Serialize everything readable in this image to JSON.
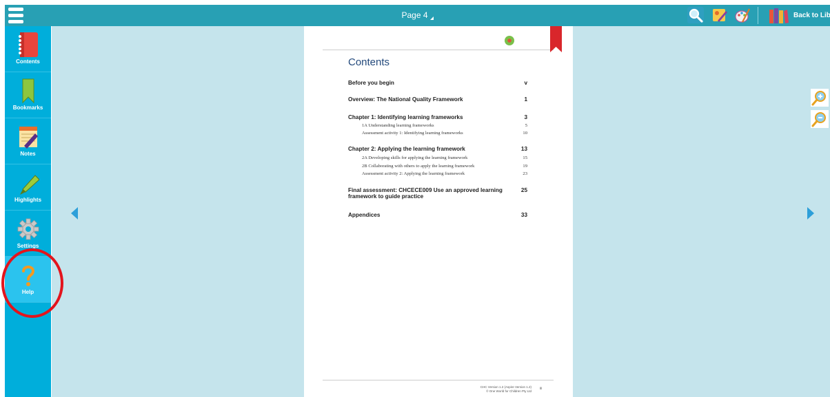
{
  "topbar": {
    "page_label": "Page 4",
    "icons": [
      "menu-icon",
      "search-icon",
      "annotate-icon",
      "draw-icon",
      "library-icon"
    ],
    "back_label": "Back to Library",
    "colors": {
      "bar": "#28a0b4",
      "text": "#ffffff"
    }
  },
  "sidebar": {
    "items": [
      {
        "label": "Contents",
        "icon": "notebook-icon"
      },
      {
        "label": "Bookmarks",
        "icon": "bookmark-icon"
      },
      {
        "label": "Notes",
        "icon": "notes-icon"
      },
      {
        "label": "Highlights",
        "icon": "highlighter-icon"
      },
      {
        "label": "Settings",
        "icon": "gear-icon"
      },
      {
        "label": "Help",
        "icon": "help-icon"
      }
    ],
    "active": "Help",
    "colors": {
      "bg": "#00aedb",
      "active": "#2bc3ee"
    }
  },
  "document": {
    "title": "Contents",
    "toc": [
      {
        "title": "Before you begin",
        "page": "v",
        "level": 1
      },
      {
        "title": "Overview: The National Quality Framework",
        "page": "1",
        "level": 1
      },
      {
        "title": "Chapter 1: Identifying learning frameworks",
        "page": "3",
        "level": 1
      },
      {
        "title": "1A  Understanding learning frameworks",
        "page": "5",
        "level": 2
      },
      {
        "title": "Assessment activity 1: Identifying learning frameworks",
        "page": "10",
        "level": 2
      },
      {
        "title": "Chapter 2: Applying the learning framework",
        "page": "13",
        "level": 1
      },
      {
        "title": "2A  Developing skills for applying the learning framework",
        "page": "15",
        "level": 2
      },
      {
        "title": "2B  Collaborating with others to apply the learning framework",
        "page": "19",
        "level": 2
      },
      {
        "title": "Assessment activity 2: Applying the learning framework",
        "page": "23",
        "level": 2
      },
      {
        "title_line1": "Final assessment: CHCECE009 Use an approved learning",
        "title_line2": "framework to guide practice",
        "page": "25",
        "level": 1
      },
      {
        "title": "Appendices",
        "page": "33",
        "level": 1
      }
    ],
    "footer_line1": "CHC Version 1.2 (Aspire Version 1.2)",
    "footer_line2": "© One World for Children Pty Ltd",
    "footer_page": "iii",
    "colors": {
      "title": "#244a7c",
      "ribbon": "#d9262b"
    }
  },
  "viewer": {
    "prev_icon": "arrow-left-icon",
    "next_icon": "arrow-right-icon",
    "zoom_in_icon": "zoom-in-icon",
    "zoom_out_icon": "zoom-out-icon",
    "bg": "#c5e4ec"
  },
  "annotation": {
    "highlight_color": "#e3141c",
    "target": "Help"
  }
}
